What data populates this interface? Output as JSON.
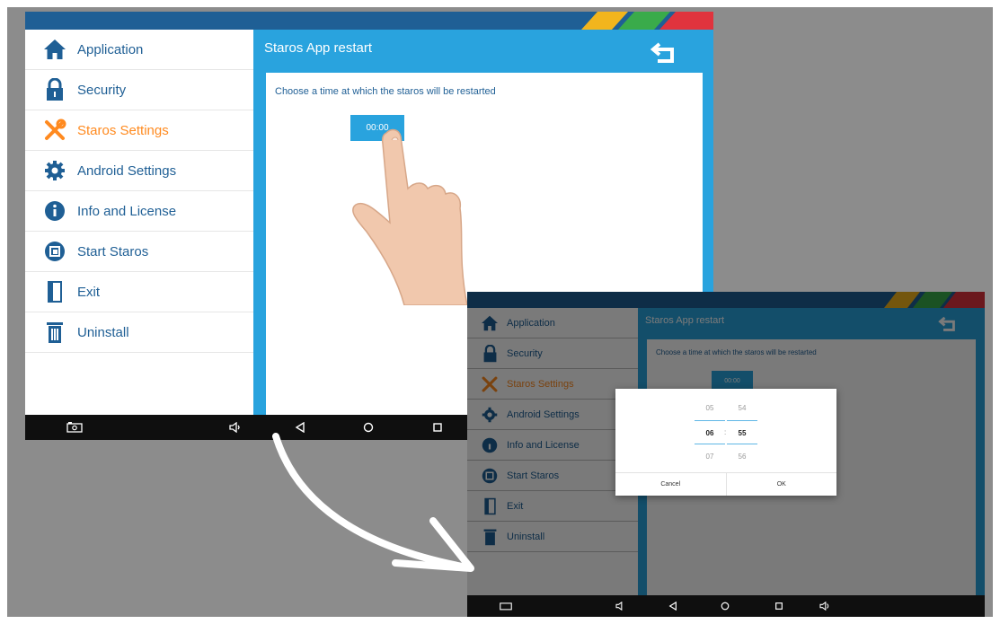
{
  "colors": {
    "primary": "#29a3de",
    "dark_blue": "#1f5f95",
    "accent_orange": "#ff8a1f",
    "stripe_green": "#3aab4a",
    "stripe_red": "#e0333d",
    "stripe_yellow": "#f2b51d",
    "navbar": "#0f0f0f"
  },
  "sidebar": {
    "items": [
      {
        "label": "Application",
        "icon": "home-icon"
      },
      {
        "label": "Security",
        "icon": "lock-icon"
      },
      {
        "label": "Staros Settings",
        "icon": "tools-icon",
        "active": true
      },
      {
        "label": "Android Settings",
        "icon": "gear-icon"
      },
      {
        "label": "Info and License",
        "icon": "info-icon"
      },
      {
        "label": "Start Staros",
        "icon": "start-icon"
      },
      {
        "label": "Exit",
        "icon": "door-icon"
      },
      {
        "label": "Uninstall",
        "icon": "trash-icon"
      }
    ]
  },
  "header": {
    "title": "Staros App restart",
    "back_icon": "back-icon"
  },
  "content": {
    "instruction": "Choose a time at which the staros will be restarted",
    "time_value": "00:00",
    "time_value_2": "00:00"
  },
  "time_picker": {
    "hours": [
      "05",
      "06",
      "07"
    ],
    "minutes": [
      "54",
      "55",
      "56"
    ],
    "separator": ":",
    "cancel_label": "Cancel",
    "ok_label": "OK"
  },
  "navbar": {
    "icons": [
      "screenshot-icon",
      "volume-down-icon",
      "back-nav-icon",
      "home-nav-icon",
      "recents-icon",
      "volume-up-icon"
    ]
  }
}
